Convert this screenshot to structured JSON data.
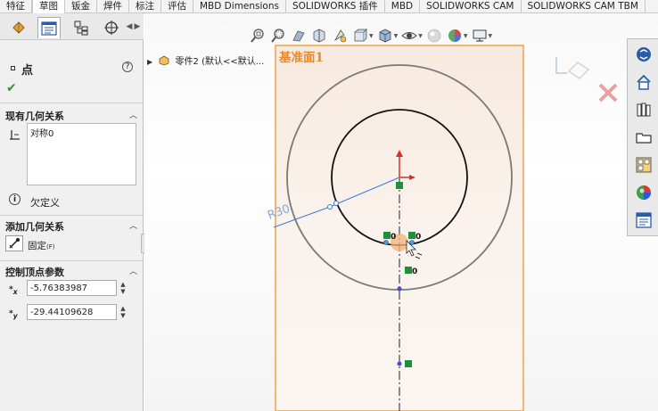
{
  "tabs": [
    {
      "label": "特征",
      "active": false
    },
    {
      "label": "草图",
      "active": true
    },
    {
      "label": "钣金",
      "active": false
    },
    {
      "label": "焊件",
      "active": false
    },
    {
      "label": "标注",
      "active": false
    },
    {
      "label": "评估",
      "active": false
    },
    {
      "label": "MBD Dimensions",
      "active": false
    },
    {
      "label": "SOLIDWORKS 插件",
      "active": false
    },
    {
      "label": "MBD",
      "active": false
    },
    {
      "label": "SOLIDWORKS CAM",
      "active": false
    },
    {
      "label": "SOLIDWORKS CAM TBM",
      "active": false
    }
  ],
  "property_manager": {
    "title": "点",
    "help_icon": "help-icon",
    "ok_icon": "check-icon",
    "existing_relations": {
      "heading": "现有几何关系",
      "items": [
        "对称0"
      ]
    },
    "status_text": "欠定义",
    "add_relations": {
      "heading": "添加几何关系",
      "fixed_label": "固定",
      "fixed_shortcut": "(F)"
    },
    "parameters": {
      "heading": "控制顶点参数",
      "x_label": "x",
      "x_value": "-5.76383987",
      "y_label": "y",
      "y_value": "-29.44109628"
    }
  },
  "feature_tree": {
    "item": "零件2 (默认<<默认..."
  },
  "canvas": {
    "plane_label": "基准面1",
    "dimension_label": "R30",
    "relation_markers": [
      "0",
      "0",
      "0"
    ]
  },
  "colors": {
    "plane_border": "#f0a04b",
    "plane_label": "#e88a2a",
    "dimension": "#3c78d8",
    "relation_green": "#1e8f3a",
    "active_point": "#f3b278"
  }
}
